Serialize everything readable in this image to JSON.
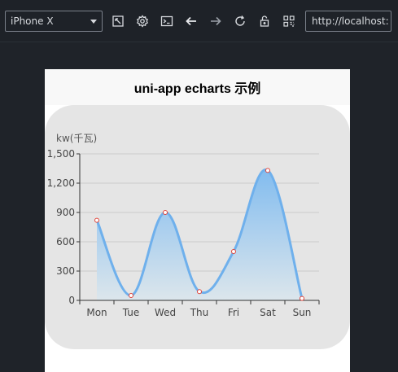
{
  "toolbar": {
    "device": "iPhone X",
    "url": "http://localhost:",
    "icons": [
      "rotate-icon",
      "settings-icon",
      "terminal-icon",
      "back-arrow-icon",
      "forward-arrow-icon",
      "refresh-icon",
      "lock-icon",
      "qr-code-icon"
    ]
  },
  "page": {
    "title": "uni-app echarts 示例"
  },
  "colors": {
    "line": "#6fb0ec",
    "area_top": "#82bcef",
    "area_bottom": "#dce6ec",
    "point_stroke": "#e0443a",
    "card_bg": "#e5e5e5"
  },
  "chart_data": {
    "type": "area",
    "categories": [
      "Mon",
      "Tue",
      "Wed",
      "Thu",
      "Fri",
      "Sat",
      "Sun"
    ],
    "values": [
      820,
      50,
      900,
      90,
      500,
      1330,
      20
    ],
    "ylabel": "kw(千瓦)",
    "ylim": [
      0,
      1500
    ],
    "yticks": [
      "0",
      "300",
      "600",
      "900",
      "1,200",
      "1,500"
    ],
    "smooth": true,
    "grid": "horizontal"
  }
}
